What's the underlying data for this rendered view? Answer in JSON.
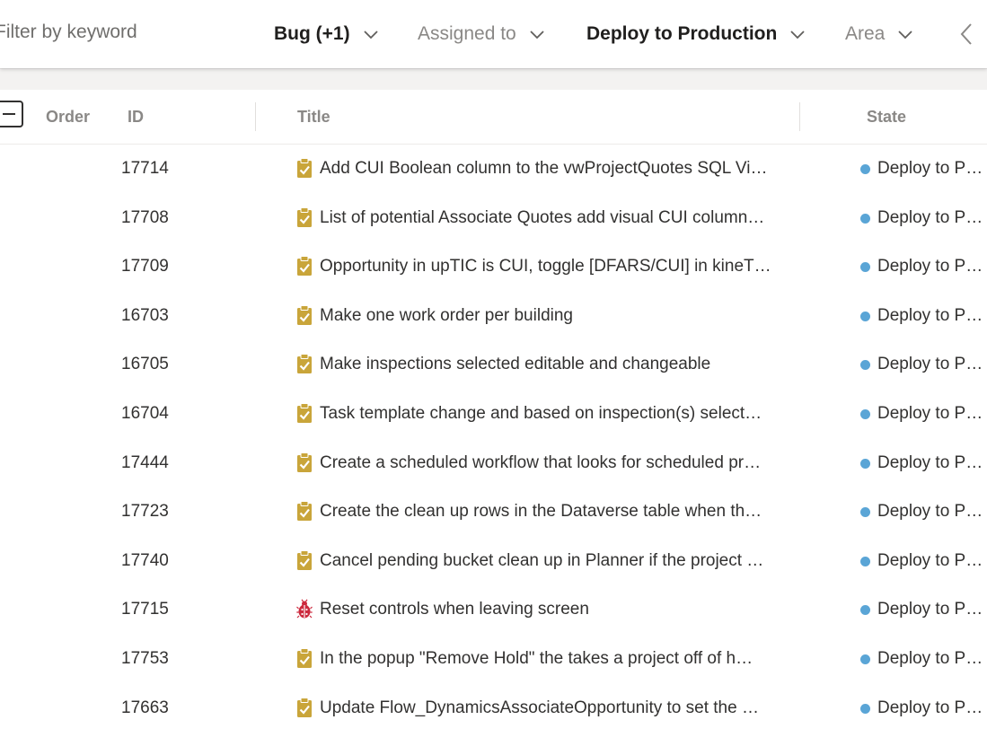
{
  "filter_bar": {
    "keyword_placeholder": "Filter by keyword",
    "filters": [
      {
        "label": "Bug (+1)",
        "active": true
      },
      {
        "label": "Assigned to",
        "active": false
      },
      {
        "label": "Deploy to Production",
        "active": true
      },
      {
        "label": "Area",
        "active": false
      }
    ]
  },
  "table": {
    "columns": [
      "Order",
      "ID",
      "Title",
      "State"
    ],
    "rows": [
      {
        "id": "17714",
        "type": "task-icon",
        "title": "Add CUI Boolean column to the vwProjectQuotes SQL Vi…",
        "state": "Deploy to Pr…"
      },
      {
        "id": "17708",
        "type": "task-icon",
        "title": "List of potential Associate Quotes add visual CUI column…",
        "state": "Deploy to Pr…"
      },
      {
        "id": "17709",
        "type": "task-icon",
        "title": "Opportunity in upTIC is CUI, toggle [DFARS/CUI] in kineT…",
        "state": "Deploy to Pr…"
      },
      {
        "id": "16703",
        "type": "task-icon",
        "title": "Make one work order per building",
        "state": "Deploy to Pr…"
      },
      {
        "id": "16705",
        "type": "task-icon",
        "title": "Make inspections selected editable and changeable",
        "state": "Deploy to Pr…"
      },
      {
        "id": "16704",
        "type": "task-icon",
        "title": "Task template change and based on inspection(s) select…",
        "state": "Deploy to Pr…"
      },
      {
        "id": "17444",
        "type": "task-icon",
        "title": "Create a scheduled workflow that looks for scheduled pr…",
        "state": "Deploy to Pr…"
      },
      {
        "id": "17723",
        "type": "task-icon",
        "title": "Create the clean up rows in the Dataverse table when th…",
        "state": "Deploy to Pr…"
      },
      {
        "id": "17740",
        "type": "task-icon",
        "title": "Cancel pending bucket clean up in Planner if the project …",
        "state": "Deploy to Pr…"
      },
      {
        "id": "17715",
        "type": "bug-icon",
        "title": "Reset controls when leaving screen",
        "state": "Deploy to Pr…"
      },
      {
        "id": "17753",
        "type": "task-icon",
        "title": "In the popup \"Remove Hold\" the takes a project off of h…",
        "state": "Deploy to Pr…"
      },
      {
        "id": "17663",
        "type": "task-icon",
        "title": "Update Flow_DynamicsAssociateOpportunity to set the …",
        "state": "Deploy to Pr…"
      }
    ]
  },
  "colors": {
    "task_icon": "#c9a53a",
    "bug_icon": "#cc293d",
    "state_dot": "#5aa5d6"
  }
}
